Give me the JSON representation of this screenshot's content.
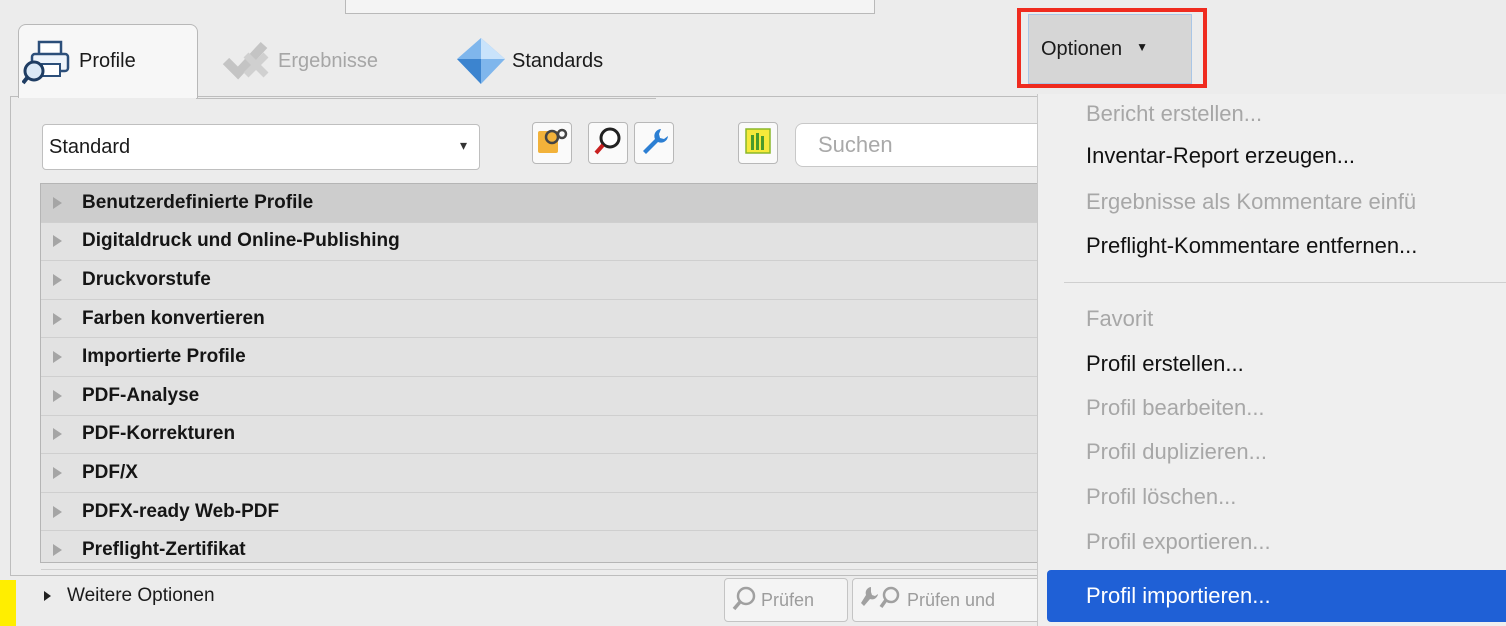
{
  "tabs": [
    {
      "label": "Profile",
      "icon": "printer-magnifier-icon",
      "active": true
    },
    {
      "label": "Ergebnisse",
      "icon": "checkmark-icon",
      "active": false
    },
    {
      "label": "Standards",
      "icon": "diamond-icon",
      "active": false
    }
  ],
  "profile_select": {
    "value": "Standard"
  },
  "search": {
    "placeholder": "Suchen"
  },
  "profile_groups": [
    "Benutzerdefinierte Profile",
    "Digitaldruck und Online-Publishing",
    "Druckvorstufe",
    "Farben konvertieren",
    "Importierte Profile",
    "PDF-Analyse",
    "PDF-Korrekturen",
    "PDF/X",
    "PDFX-ready Web-PDF",
    "Preflight-Zertifikat"
  ],
  "footer": {
    "more_options": "Weitere Optionen",
    "pruefen": "Prüfen",
    "pruefen_und": "Prüfen und"
  },
  "options_button": {
    "label": "Optionen"
  },
  "options_menu": [
    {
      "label": "Bericht erstellen...",
      "enabled": false
    },
    {
      "label": "Inventar-Report erzeugen...",
      "enabled": true
    },
    {
      "label": "Ergebnisse als Kommentare einfü",
      "enabled": false
    },
    {
      "label": "Preflight-Kommentare entfernen...",
      "enabled": true
    },
    {
      "label": "Favorit",
      "enabled": false
    },
    {
      "label": "Profil erstellen...",
      "enabled": true
    },
    {
      "label": "Profil bearbeiten...",
      "enabled": false
    },
    {
      "label": "Profil duplizieren...",
      "enabled": false
    },
    {
      "label": "Profil löschen...",
      "enabled": false
    },
    {
      "label": "Profil exportieren...",
      "enabled": false
    },
    {
      "label": "Profil importieren...",
      "enabled": true,
      "highlighted": true
    }
  ],
  "colors": {
    "accent": "#1f60d6",
    "highlight_box": "#ef2b1f",
    "marker": "#ffee00"
  }
}
